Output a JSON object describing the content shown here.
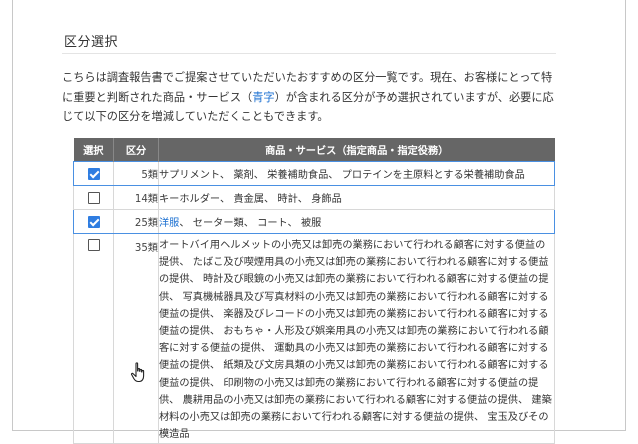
{
  "section": {
    "title": "区分選択",
    "intro_pre": "こちらは調査報告書でご提案させていただいたおすすめの区分一覧です。現在、お客様にとって特に重要と判断された商品・サービス（",
    "intro_hl": "青字",
    "intro_post": "）が含まれる区分が予め選択されていますが、必要に応じて以下の区分を増減していただくこともできます。"
  },
  "table": {
    "headers": {
      "select": "選択",
      "class": "区分",
      "goods": "商品・サービス（指定商品・指定役務）"
    },
    "rows": [
      {
        "selected": true,
        "class": "5類",
        "goods": "サプリメント、 薬剤、 栄養補助食品、 プロテインを主原料とする栄養補助食品"
      },
      {
        "selected": false,
        "class": "14類",
        "goods": "キーホルダー、 貴金属、 時計、 身飾品"
      },
      {
        "selected": true,
        "class": "25類",
        "goods_hl": "洋服",
        "goods": "、 セーター類、 コート、 被服"
      },
      {
        "selected": false,
        "class": "35類",
        "goods": "オートバイ用ヘルメットの小売又は卸売の業務において行われる顧客に対する便益の提供、 たばこ及び喫煙用具の小売又は卸売の業務において行われる顧客に対する便益の提供、 時計及び眼鏡の小売又は卸売の業務において行われる顧客に対する便益の提供、 写真機械器具及び写真材料の小売又は卸売の業務において行われる顧客に対する便益の提供、 楽器及びレコードの小売又は卸売の業務において行われる顧客に対する便益の提供、 おもちゃ・人形及び娯楽用具の小売又は卸売の業務において行われる顧客に対する便益の提供、 運動具の小売又は卸売の業務において行われる顧客に対する便益の提供、 紙類及び文房具類の小売又は卸売の業務において行われる顧客に対する便益の提供、 印刷物の小売又は卸売の業務において行われる顧客に対する便益の提供、 農耕用品の小売又は卸売の業務において行われる顧客に対する便益の提供、 建築材料の小売又は卸売の業務において行われる顧客に対する便益の提供、 宝玉及びその模造品"
      }
    ]
  },
  "colors": {
    "accent": "#2f7de1",
    "highlight_text": "#1a6fd1",
    "header_bg": "#666666"
  },
  "icons": {
    "cursor": "hand-pointer-icon"
  }
}
